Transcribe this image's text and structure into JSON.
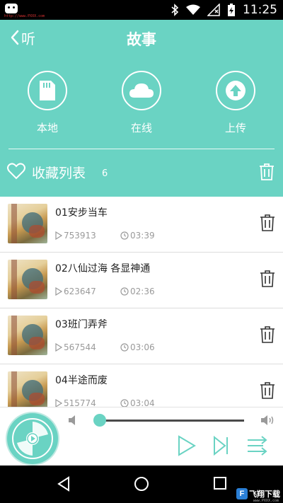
{
  "status_bar": {
    "time": "11:25",
    "url_overlay": "http://www.PXXX.com",
    "icons": [
      "app-icon",
      "bluetooth-icon",
      "wifi-icon",
      "sim-no-signal-icon",
      "battery-charging-icon"
    ]
  },
  "header": {
    "back_label": "听",
    "title": "故事",
    "nav": [
      {
        "label": "本地",
        "icon": "sd-card-icon"
      },
      {
        "label": "在线",
        "icon": "cloud-icon"
      },
      {
        "label": "上传",
        "icon": "upload-arrow-icon"
      }
    ],
    "favorites": {
      "title": "收藏列表",
      "count": "6"
    }
  },
  "stories": [
    {
      "title": "01安步当车",
      "plays": "753913",
      "duration": "03:39"
    },
    {
      "title": "02八仙过海 各显神通",
      "plays": "623647",
      "duration": "02:36"
    },
    {
      "title": "03班门弄斧",
      "plays": "567544",
      "duration": "03:06"
    },
    {
      "title": "04半途而废",
      "plays": "515774",
      "duration": "03:04"
    }
  ],
  "player": {
    "progress": 0.0,
    "icons": [
      "disc-icon",
      "volume-low-icon",
      "volume-high-icon",
      "play-icon",
      "next-icon",
      "playlist-order-icon"
    ]
  },
  "nav_bar": {
    "icons": [
      "back-triangle-icon",
      "home-circle-icon",
      "recents-square-icon"
    ]
  },
  "watermark": {
    "logo": "F",
    "text": "飞翔下载",
    "url": "www.PXXX.com"
  },
  "colors": {
    "accent": "#6ad3c3",
    "status_bar": "#000000",
    "meta_text": "#9a9a9a"
  }
}
